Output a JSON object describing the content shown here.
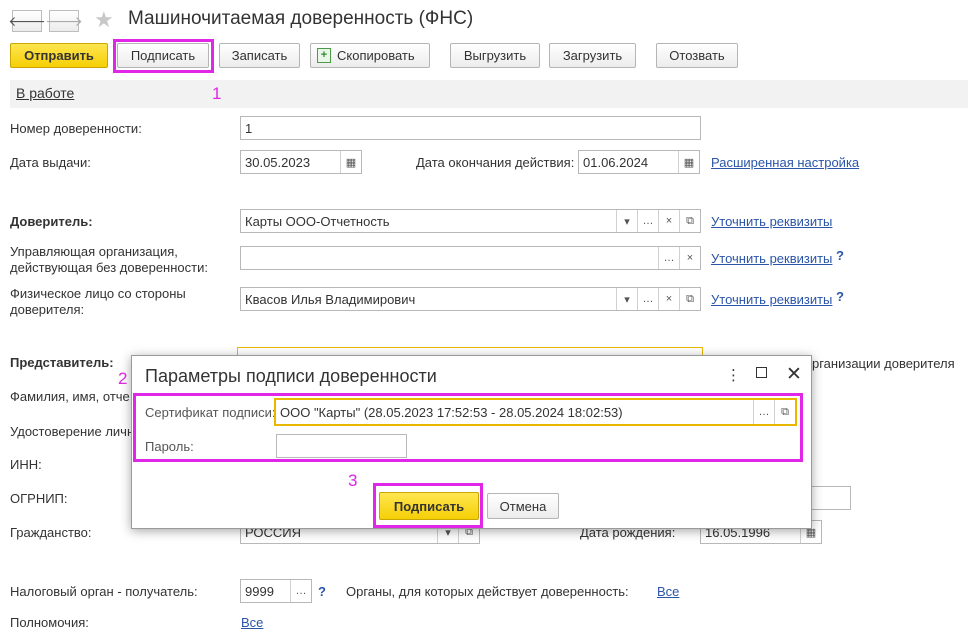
{
  "window": {
    "title": "Машиночитаемая доверенность (ФНС)"
  },
  "toolbar": {
    "send": "Отправить",
    "sign": "Подписать",
    "save": "Записать",
    "copy": "Скопировать",
    "export": "Выгрузить",
    "import": "Загрузить",
    "revoke": "Отозвать"
  },
  "status": "В работе",
  "annotations": [
    "1",
    "2",
    "3"
  ],
  "form": {
    "number_label": "Номер доверенности:",
    "number_value": "1",
    "issue_date_label": "Дата выдачи:",
    "issue_date_value": "30.05.2023",
    "end_date_label": "Дата окончания действия:",
    "end_date_value": "01.06.2024",
    "advanced_link": "Расширенная настройка",
    "principal_label": "Доверитель:",
    "principal_value": "Карты ООО-Отчетность",
    "clarify_link": "Уточнить реквизиты",
    "managing_org_label_1": "Управляющая организация,",
    "managing_org_label_2": "действующая без доверенности:",
    "managing_org_value": "",
    "person_label_1": "Физическое лицо со стороны",
    "person_label_2": "доверителя:",
    "person_value": "Квасов Илья Владимирович",
    "representative_label": "Представитель:",
    "representative_org_text_partial": "рганизации доверителя",
    "fio_label_partial": "Фамилия, имя, отче",
    "id_doc_label_partial": "Удостоверение личн",
    "inn_label": "ИНН:",
    "ogrnip_label": "ОГРНИП:",
    "citizenship_label": "Гражданство:",
    "citizenship_value": "РОССИЯ",
    "birth_date_label": "Дата рождения:",
    "birth_date_value": "16.05.1996",
    "tax_authority_label": "Налоговый орган - получатель:",
    "tax_authority_value": "9999",
    "bodies_label": "Органы, для которых действует доверенность:",
    "bodies_link": "Все",
    "powers_label": "Полномочия:",
    "powers_link": "Все",
    "help_mark": "?"
  },
  "dialog": {
    "title": "Параметры подписи доверенности",
    "cert_label": "Сертификат подписи:",
    "cert_value": "ООО \"Карты\" (28.05.2023 17:52:53 - 28.05.2024 18:02:53)",
    "password_label": "Пароль:",
    "password_value": "",
    "sign_button": "Подписать",
    "cancel_button": "Отмена"
  },
  "colors": {
    "accent_yellow": "#f5cf06",
    "highlight_magenta": "#e026e6",
    "link_blue": "#2a55a8",
    "focus_border": "#e8b800"
  }
}
